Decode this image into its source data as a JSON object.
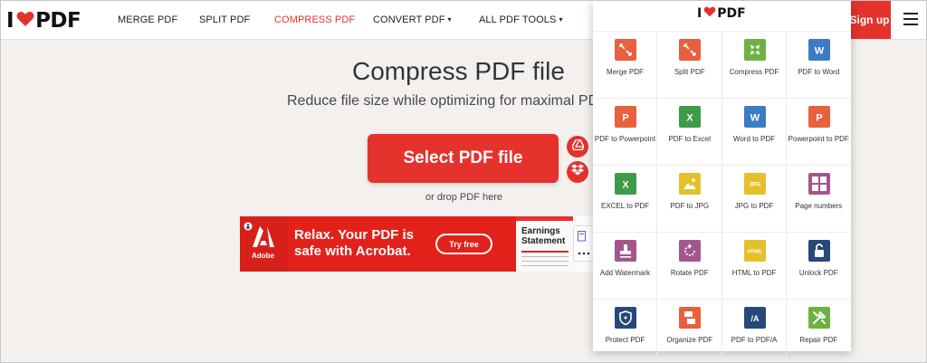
{
  "logo": {
    "left": "I",
    "right": "PDF"
  },
  "nav": {
    "merge": "MERGE PDF",
    "split": "SPLIT PDF",
    "compress": "COMPRESS PDF",
    "convert": "CONVERT PDF",
    "all_tools": "ALL PDF TOOLS",
    "caret": "▾",
    "signup": "Sign up"
  },
  "main": {
    "title": "Compress PDF file",
    "subtitle": "Reduce file size while optimizing for maximal PDF",
    "select_label": "Select PDF file",
    "drop_text": "or drop PDF here"
  },
  "ad": {
    "brand": "Adobe",
    "headline": "Relax. Your PDF is safe with Acrobat.",
    "cta": "Try free",
    "doc_title": "Earnings Statement"
  },
  "colors": {
    "accent": "#e5322d",
    "text": "#33333b",
    "background": "#f3f0ed"
  },
  "tools": [
    {
      "label": "Merge PDF",
      "icon": "merge-icon",
      "color": "#e8603e"
    },
    {
      "label": "Split PDF",
      "icon": "split-icon",
      "color": "#e8603e"
    },
    {
      "label": "Compress PDF",
      "icon": "compress-icon",
      "color": "#6fb043"
    },
    {
      "label": "PDF to Word",
      "icon": "word-icon",
      "color": "#3d7bc7"
    },
    {
      "label": "PDF to Powerpoint",
      "icon": "powerpoint-icon",
      "color": "#e8603e"
    },
    {
      "label": "PDF to Excel",
      "icon": "excel-icon",
      "color": "#3e9b47"
    },
    {
      "label": "Word to PDF",
      "icon": "word-icon",
      "color": "#3d7bc7"
    },
    {
      "label": "Powerpoint to PDF",
      "icon": "powerpoint-icon",
      "color": "#e8603e"
    },
    {
      "label": "EXCEL to PDF",
      "icon": "excel-icon",
      "color": "#3e9b47"
    },
    {
      "label": "PDF to JPG",
      "icon": "image-icon",
      "color": "#e5c02b"
    },
    {
      "label": "JPG to PDF",
      "icon": "jpg-icon",
      "color": "#e5c02b"
    },
    {
      "label": "Page numbers",
      "icon": "page-numbers-icon",
      "color": "#a4568c"
    },
    {
      "label": "Add Watermark",
      "icon": "stamp-icon",
      "color": "#a4568c"
    },
    {
      "label": "Rotate PDF",
      "icon": "rotate-icon",
      "color": "#a4568c"
    },
    {
      "label": "HTML to PDF",
      "icon": "html-icon",
      "color": "#e5c02b"
    },
    {
      "label": "Unlock PDF",
      "icon": "unlock-icon",
      "color": "#27497a"
    },
    {
      "label": "Protect PDF",
      "icon": "shield-icon",
      "color": "#27497a"
    },
    {
      "label": "Organize PDF",
      "icon": "organize-icon",
      "color": "#e8603e"
    },
    {
      "label": "PDF to PDF/A",
      "icon": "pdfa-icon",
      "color": "#27497a"
    },
    {
      "label": "Repair PDF",
      "icon": "repair-icon",
      "color": "#6fb043"
    }
  ]
}
